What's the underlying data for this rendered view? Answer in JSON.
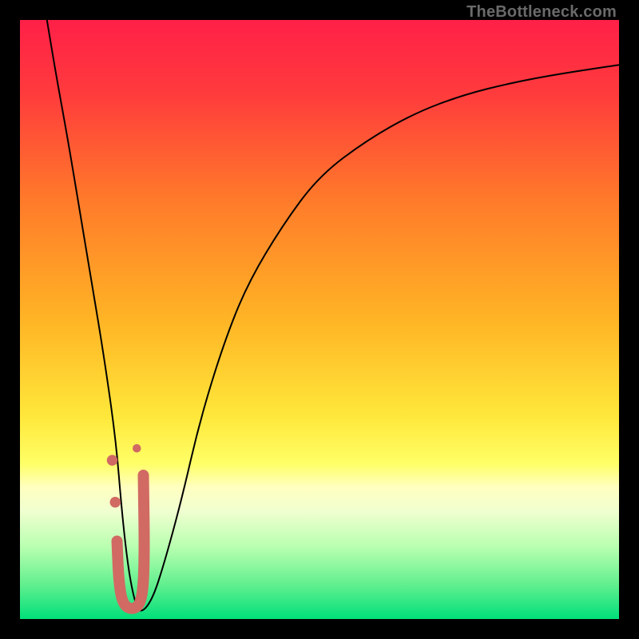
{
  "watermark": "TheBottleneck.com",
  "chart_data": {
    "type": "line",
    "title": "",
    "xlabel": "",
    "ylabel": "",
    "xlim": [
      0,
      100
    ],
    "ylim": [
      0,
      100
    ],
    "gradient_stops": [
      {
        "pct": 0,
        "color": "#ff2048"
      },
      {
        "pct": 12,
        "color": "#ff3a3d"
      },
      {
        "pct": 30,
        "color": "#ff7a2a"
      },
      {
        "pct": 50,
        "color": "#ffb425"
      },
      {
        "pct": 66,
        "color": "#ffe73a"
      },
      {
        "pct": 74,
        "color": "#ffff66"
      },
      {
        "pct": 78,
        "color": "#ffffc0"
      },
      {
        "pct": 82,
        "color": "#f0ffd0"
      },
      {
        "pct": 88,
        "color": "#b8ffb0"
      },
      {
        "pct": 94,
        "color": "#66f090"
      },
      {
        "pct": 100,
        "color": "#00e07a"
      }
    ],
    "series": [
      {
        "name": "bottleneck-curve",
        "x": [
          4.5,
          6,
          8,
          10,
          12,
          14,
          16,
          17,
          18,
          19,
          20,
          22,
          24,
          27,
          30,
          34,
          38,
          44,
          50,
          58,
          66,
          74,
          82,
          90,
          100
        ],
        "y": [
          100,
          91,
          80,
          68,
          56,
          44,
          30,
          18,
          9,
          3.5,
          0.8,
          3,
          9,
          20,
          33,
          46,
          56,
          66,
          74,
          80,
          84.5,
          87.5,
          89.5,
          91,
          92.5
        ]
      }
    ],
    "markers": [
      {
        "name": "dot-upper",
        "x": 15.4,
        "y": 26.5,
        "r": 0.9,
        "color": "#d16a63"
      },
      {
        "name": "dot-lower",
        "x": 15.9,
        "y": 19.5,
        "r": 0.9,
        "color": "#d16a63"
      },
      {
        "name": "hook-top-small",
        "x": 19.5,
        "y": 28.5,
        "r": 0.7,
        "color": "#d16a63"
      }
    ],
    "hook": {
      "name": "j-hook",
      "color": "#d16a63",
      "points_xy": [
        [
          16.2,
          13.0
        ],
        [
          16.5,
          6.0
        ],
        [
          17.2,
          2.3
        ],
        [
          19.0,
          1.5
        ],
        [
          20.4,
          3.0
        ],
        [
          20.8,
          10.0
        ],
        [
          20.6,
          24.0
        ]
      ]
    }
  }
}
